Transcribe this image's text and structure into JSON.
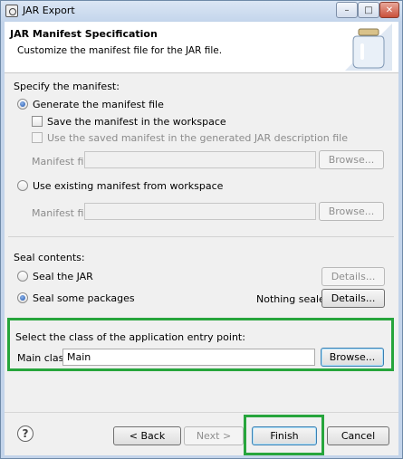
{
  "window": {
    "title": "JAR Export"
  },
  "window_controls": {
    "minimize": "–",
    "maximize": "□",
    "close": "✕"
  },
  "header": {
    "title": "JAR Manifest Specification",
    "description": "Customize the manifest file for the JAR file."
  },
  "specify": {
    "label": "Specify the manifest:",
    "generate_label": "Generate the manifest file",
    "save_label": "Save the manifest in the workspace",
    "use_saved_label": "Use the saved manifest in the generated JAR description file",
    "manifest_file_label": "Manifest file:",
    "manifest_file_value": "",
    "browse_label": "Browse...",
    "use_existing_label": "Use existing manifest from workspace",
    "existing_manifest_file_label": "Manifest file:",
    "existing_manifest_file_value": "",
    "existing_browse_label": "Browse..."
  },
  "seal": {
    "label": "Seal contents:",
    "seal_jar_label": "Seal the JAR",
    "seal_jar_details": "Details...",
    "seal_some_label": "Seal some packages",
    "status": "Nothing sealed",
    "seal_some_details": "Details..."
  },
  "entry_point": {
    "label": "Select the class of the application entry point:",
    "main_class_label": "Main class:",
    "main_class_value": "Main",
    "browse_label": "Browse..."
  },
  "footer": {
    "help": "?",
    "back_label": "< Back",
    "next_label": "Next >",
    "finish_label": "Finish",
    "cancel_label": "Cancel"
  },
  "highlight_color": "#27a53c"
}
